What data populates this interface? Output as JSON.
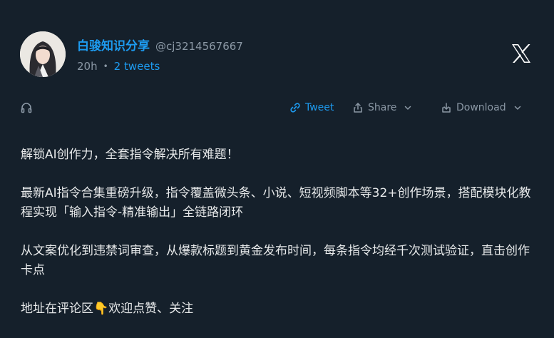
{
  "author": {
    "name": "白骏知识分享",
    "handle": "@cj3214567667",
    "time": "20h",
    "separator": "•",
    "tweet_count": "2 tweets"
  },
  "brand": {
    "logo_icon": "x-logo-icon"
  },
  "toolbar": {
    "audio_icon": "headphones-icon",
    "tweet_label": "Tweet",
    "share_label": "Share",
    "download_label": "Download"
  },
  "content": {
    "paragraphs": [
      "解锁AI创作力，全套指令解决所有难题！",
      "最新AI指令合集重磅升级，指令覆盖微头条、小说、短视频脚本等32+创作场景，搭配模块化教程实现「输入指令-精准输出」全链路闭环",
      "从文案优化到违禁词审查，从爆款标题到黄金发布时间，每条指令均经千次测试验证，直击创作卡点",
      "地址在评论区👇欢迎点赞、关注"
    ]
  },
  "colors": {
    "background": "#15202b",
    "accent": "#1d9bf0",
    "muted": "#8b98a5",
    "text": "#e7e9ea"
  }
}
